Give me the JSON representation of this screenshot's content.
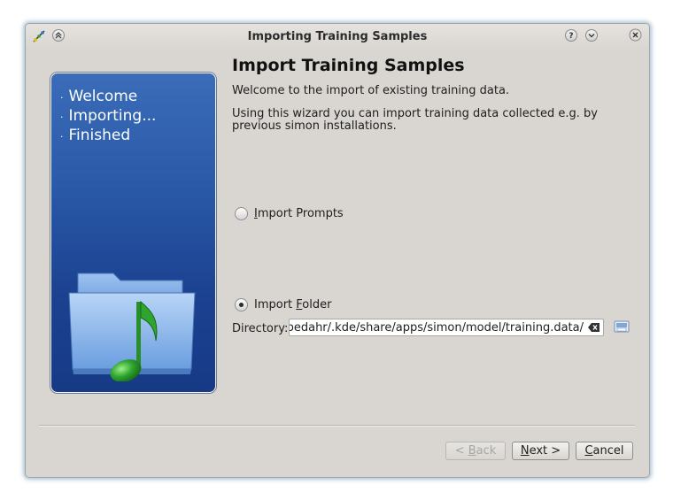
{
  "window": {
    "title": "Importing Training Samples",
    "help_icon": "help-icon",
    "minimize_icon": "chevron-down-icon",
    "close_icon": "close-icon",
    "keep_above_icon": "chevron-up-icon"
  },
  "sidebar": {
    "steps": [
      {
        "label": "Welcome"
      },
      {
        "label": "Importing..."
      },
      {
        "label": "Finished"
      }
    ],
    "bullet": "·",
    "art_icon": "music-folder-icon",
    "colors": {
      "panel_top": "#3b6cb8",
      "panel_bottom": "#173a86",
      "note": "#2fa52f"
    }
  },
  "main": {
    "heading": "Import Training Samples",
    "intro": "Welcome to the import of existing training data.",
    "description": "Using this wizard you can import training data collected e.g. by previous simon installations.",
    "options": [
      {
        "mnemonic": "I",
        "label_rest": "mport Prompts",
        "checked": false
      },
      {
        "label_pre": "Import ",
        "mnemonic": "F",
        "label_rest": "older",
        "checked": true
      }
    ],
    "directory": {
      "label": "Directory:",
      "value": "/home/bedahr/.kde/share/apps/simon/model/training.data/"
    }
  },
  "footer": {
    "back_mnemonic": "B",
    "back_pre": "< ",
    "back_rest": "ack",
    "next_mnemonic": "N",
    "next_rest": "ext >",
    "cancel_mnemonic": "C",
    "cancel_rest": "ancel"
  }
}
